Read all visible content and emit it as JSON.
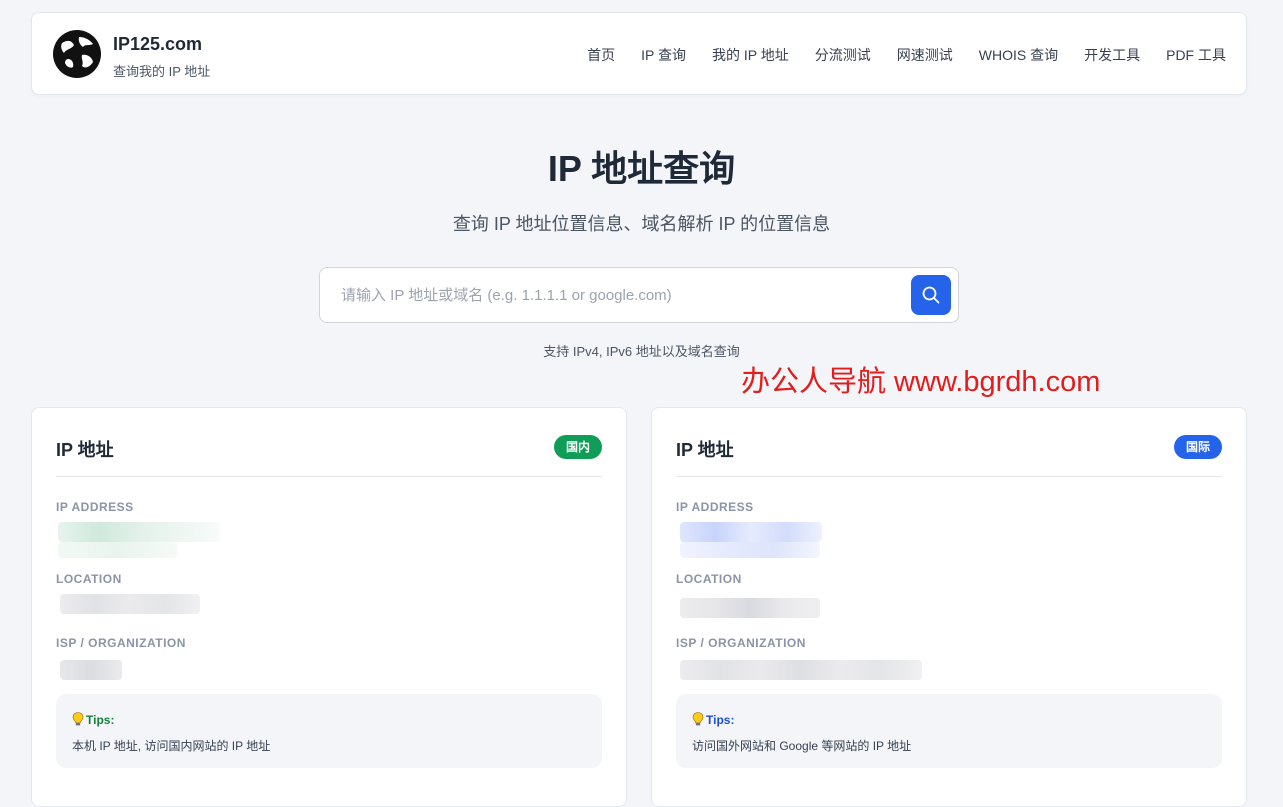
{
  "header": {
    "brand_name": "IP125.com",
    "brand_subtitle": "查询我的 IP 地址",
    "logo_icon": "globe-icon",
    "nav": [
      {
        "label": "首页"
      },
      {
        "label": "IP 查询"
      },
      {
        "label": "我的 IP 地址"
      },
      {
        "label": "分流测试"
      },
      {
        "label": "网速测试"
      },
      {
        "label": "WHOIS 查询"
      },
      {
        "label": "开发工具"
      },
      {
        "label": "PDF 工具"
      }
    ]
  },
  "hero": {
    "title": "IP 地址查询",
    "subtitle": "查询 IP 地址位置信息、域名解析 IP 的位置信息"
  },
  "search": {
    "placeholder": "请输入 IP 地址或域名 (e.g. 1.1.1.1 or google.com)",
    "value": "",
    "button_icon": "search-icon",
    "hint": "支持 IPv4, IPv6 地址以及域名查询"
  },
  "watermark": "办公人导航 www.bgrdh.com",
  "cards": [
    {
      "title": "IP 地址",
      "badge": "国内",
      "badge_color": "#0f9d58",
      "fields": [
        {
          "label": "IP ADDRESS"
        },
        {
          "label": "LOCATION"
        },
        {
          "label": "ISP / ORGANIZATION"
        }
      ],
      "tips_title": "Tips:",
      "tips_title_color": "#15803d",
      "tips_text": "本机 IP 地址, 访问国内网站的 IP 地址"
    },
    {
      "title": "IP 地址",
      "badge": "国际",
      "badge_color": "#2563eb",
      "fields": [
        {
          "label": "IP ADDRESS"
        },
        {
          "label": "LOCATION"
        },
        {
          "label": "ISP / ORGANIZATION"
        }
      ],
      "tips_title": "Tips:",
      "tips_title_color": "#1d4ed8",
      "tips_text": "访问国外网站和 Google 等网站的 IP 地址"
    }
  ],
  "colors": {
    "accent": "#2563eb",
    "background": "#f3f5f8",
    "watermark": "#e11d1d"
  }
}
